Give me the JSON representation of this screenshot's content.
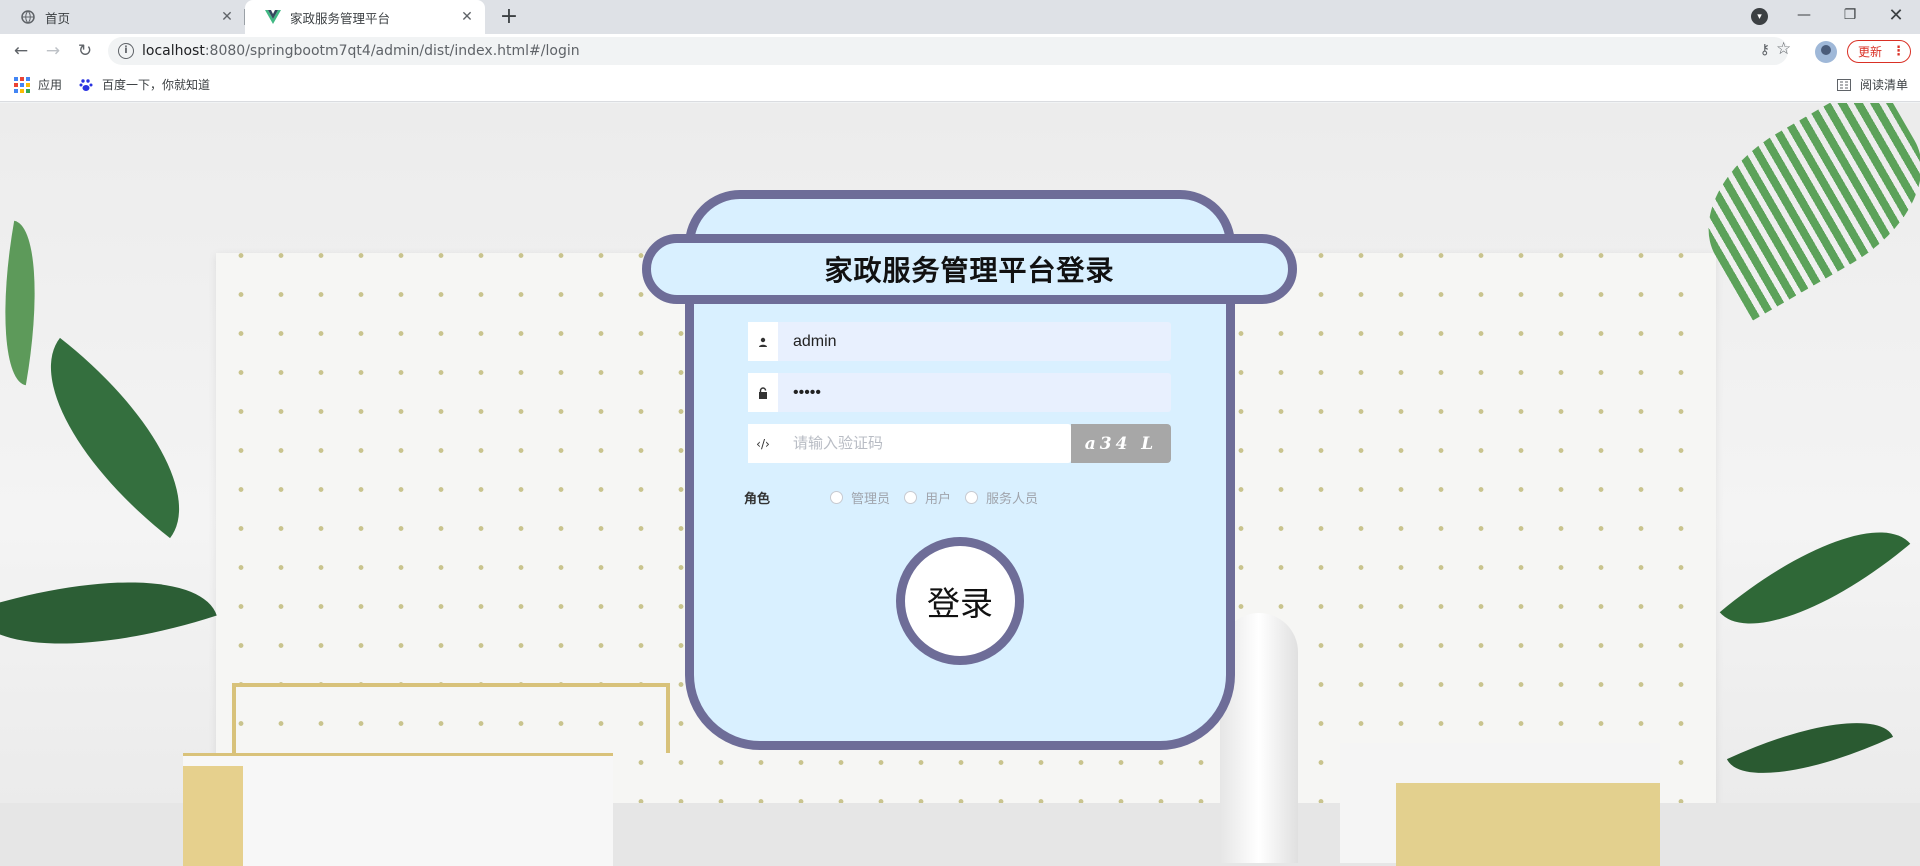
{
  "browser": {
    "tabs": [
      {
        "title": "首页",
        "icon": "globe-icon"
      },
      {
        "title": "家政服务管理平台",
        "icon": "vue-logo-icon"
      }
    ],
    "new_tab": "+",
    "url_host": "localhost",
    "url_rest": ":8080/springbootm7qt4/admin/dist/index.html#/login",
    "update_label": "更新",
    "bookmarks": [
      {
        "label": "应用",
        "icon": "apps-grid-icon"
      },
      {
        "label": "百度一下，你就知道",
        "icon": "baidu-paw-icon"
      }
    ],
    "reading_list": "阅读清单"
  },
  "login": {
    "title": "家政服务管理平台登录",
    "username_value": "admin",
    "password_value": "•••••",
    "captcha_placeholder": "请输入验证码",
    "captcha_text": "a34 L",
    "role_label": "角色",
    "roles": [
      "管理员",
      "用户",
      "服务人员"
    ],
    "submit_label": "登录"
  },
  "colors": {
    "card_bg": "#d9f0ff",
    "card_border": "#6e6d98",
    "input_bg": "#e8f0fe",
    "captcha_bg": "#a7a7a7"
  }
}
